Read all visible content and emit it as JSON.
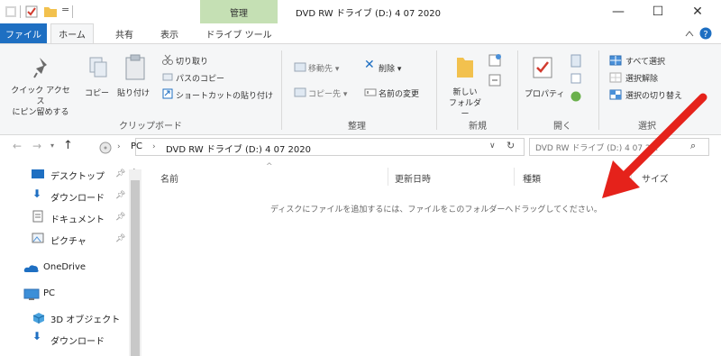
{
  "titlebar": {
    "context_tab": "管理",
    "title": "DVD RW ドライブ (D:) 4 07 2020",
    "minimize": "—",
    "maximize": "☐",
    "close": "✕",
    "qat_dropdown": "="
  },
  "ribbon_tabs": [
    "ファイル",
    "ホーム",
    "共有",
    "表示",
    "ドライブ ツール"
  ],
  "ribbon": {
    "clipboard": {
      "pin_quick_access": "クイック アクセス\nにピン留めする",
      "copy": "コピー",
      "paste": "貼り付け",
      "cut": "切り取り",
      "copy_path": "パスのコピー",
      "paste_shortcut": "ショートカットの貼り付け",
      "group_label": "クリップボード"
    },
    "organize": {
      "move_to": "移動先 ▾",
      "delete": "削除 ▾",
      "copy_to": "コピー先 ▾",
      "rename": "名前の変更",
      "group_label": "整理"
    },
    "new": {
      "new_folder": "新しい\nフォルダー",
      "group_label": "新規"
    },
    "open": {
      "properties": "プロパティ",
      "group_label": "開く"
    },
    "select": {
      "select_all": "すべて選択",
      "select_none": "選択解除",
      "invert_selection": "選択の切り替え",
      "group_label": "選択"
    }
  },
  "address": {
    "path": [
      "PC",
      "DVD RW ドライブ (D:) 4 07 2020"
    ],
    "search_placeholder": "DVD RW ドライブ (D:) 4 07 2..."
  },
  "nav": {
    "items": [
      {
        "label": "デスクトップ",
        "pinned": true
      },
      {
        "label": "ダウンロード",
        "pinned": true
      },
      {
        "label": "ドキュメント",
        "pinned": true
      },
      {
        "label": "ピクチャ",
        "pinned": true
      },
      {
        "label": "OneDrive"
      },
      {
        "label": "PC"
      },
      {
        "label": "3D オブジェクト"
      },
      {
        "label": "ダウンロード"
      }
    ]
  },
  "columns": [
    "名前",
    "更新日時",
    "種類",
    "サイズ"
  ],
  "empty_message": "ディスクにファイルを追加するには、ファイルをこのフォルダーへドラッグしてください。",
  "colors": {
    "file_tab": "#1e6fc2",
    "context_tab": "#c5e0b4",
    "arrow": "#e5221b"
  }
}
